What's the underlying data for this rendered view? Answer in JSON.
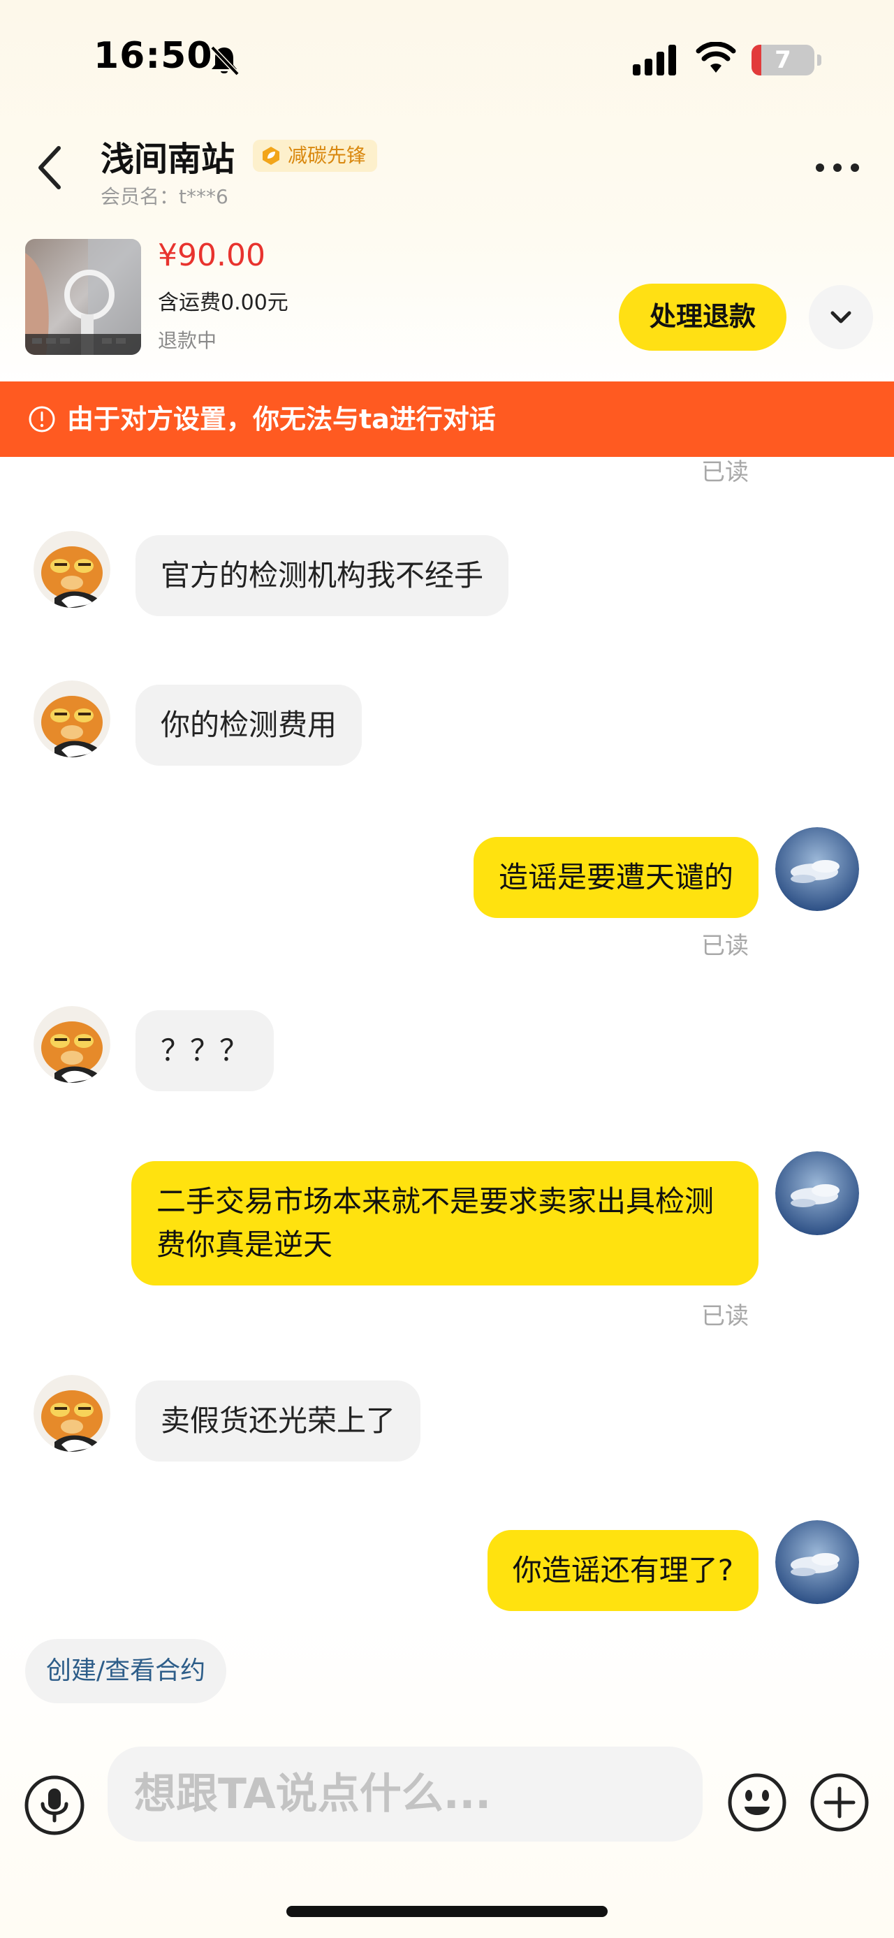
{
  "status_bar": {
    "time": "16:50",
    "battery_level": "7",
    "icons": [
      "bell-off-icon",
      "signal-icon",
      "wifi-icon",
      "battery-icon"
    ]
  },
  "header": {
    "shop_name": "浅间南站",
    "badge": "减碳先锋",
    "member_name": "会员名：t***6"
  },
  "product": {
    "price": "¥90.00",
    "shipping": "含运费0.00元",
    "status": "退款中",
    "refund_button": "处理退款"
  },
  "warning": {
    "text": "由于对方设置，你无法与ta进行对话"
  },
  "messages": [
    {
      "from": "other",
      "text": "官方的检测机构我不经手"
    },
    {
      "from": "other",
      "text": "你的检测费用"
    },
    {
      "from": "self",
      "text": "造谣是要遭天谴的",
      "read": "已读"
    },
    {
      "from": "other",
      "text": "？？？"
    },
    {
      "from": "self",
      "text": "二手交易市场本来就不是要求卖家出具检测费你真是逆天",
      "read": "已读"
    },
    {
      "from": "other",
      "text": "卖假货还光荣上了"
    },
    {
      "from": "self",
      "text": "你造谣还有理了?"
    }
  ],
  "top_read_mark": "已读",
  "bottom": {
    "contract_chip": "创建/查看合约",
    "input_placeholder": "想跟TA说点什么..."
  },
  "colors": {
    "accent_yellow": "#ffe20f",
    "warning_orange": "#ff5a21",
    "price_red": "#e8332e"
  }
}
